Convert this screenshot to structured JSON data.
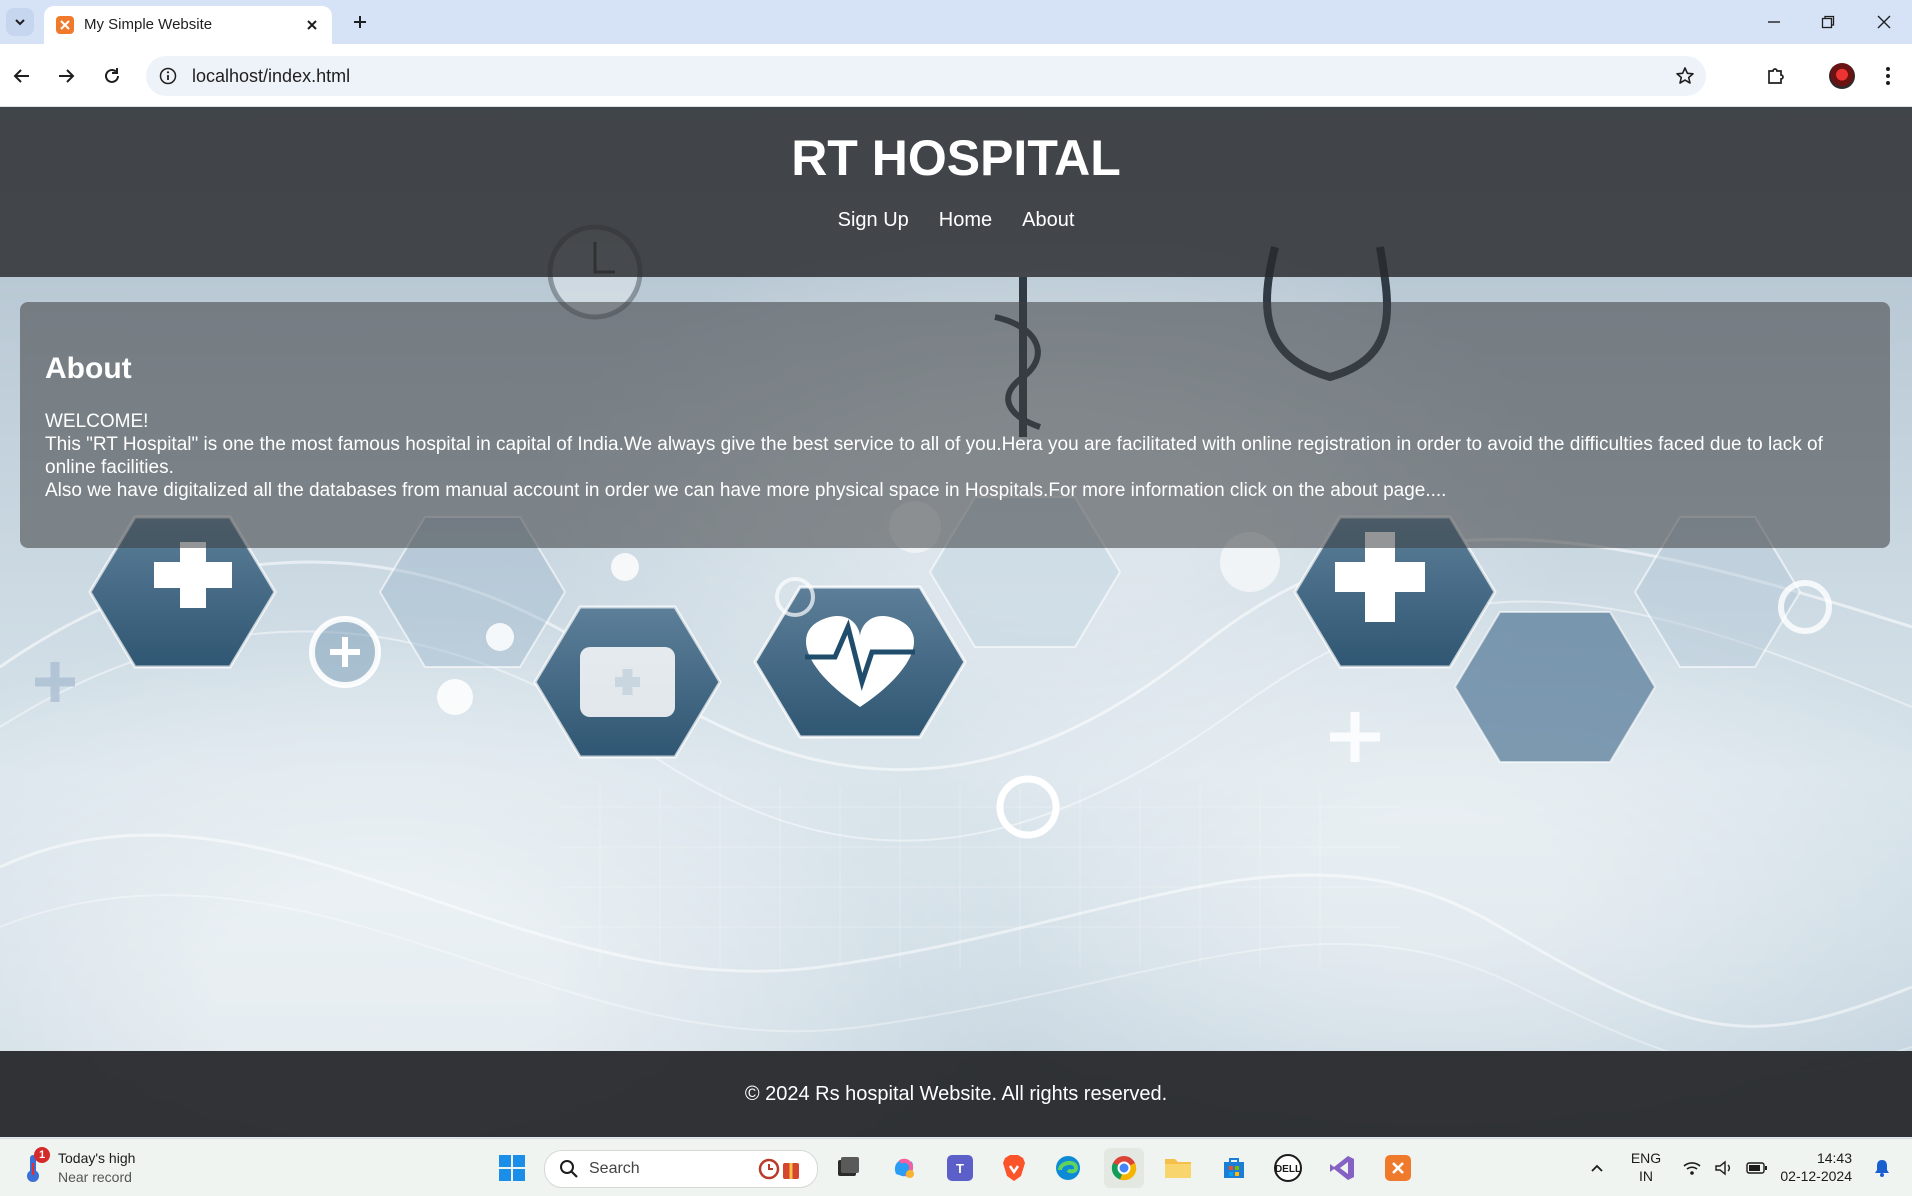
{
  "browser": {
    "tab_title": "My Simple Website",
    "url": "localhost/index.html"
  },
  "site": {
    "title": "RT HOSPITAL",
    "nav": [
      "Sign Up",
      "Home",
      "About"
    ],
    "about": {
      "heading": "About",
      "welcome": "WELCOME!",
      "paragraph1": "This \"RT Hospital\" is one the most famous hospital in capital of India.We always give the best service to all of you.Hera you are facilitated with online registration in order to avoid the difficulties faced due to lack of online facilities.",
      "paragraph2": "Also we have digitalized all the databases from manual account in order we can have more physical space in Hospitals.For more information click on the about page...."
    },
    "footer": "© 2024 Rs hospital Website. All rights reserved."
  },
  "taskbar": {
    "weather_badge": "1",
    "weather_title": "Today's high",
    "weather_subtitle": "Near record",
    "search_placeholder": "Search",
    "apps": [
      "start-icon",
      "task-view-icon",
      "copilot-icon",
      "teams-icon",
      "brave-icon",
      "edge-icon",
      "chrome-icon",
      "file-explorer-icon",
      "store-icon",
      "dell-icon",
      "visual-studio-icon",
      "xampp-icon"
    ],
    "lang_line1": "ENG",
    "lang_line2": "IN",
    "time": "14:43",
    "date": "02-12-2024"
  },
  "colors": {
    "header_bg": "#2a2c2e",
    "footer_bg": "#232528",
    "xampp_orange": "#f07a2b",
    "tab_strip": "#d6e3f7"
  }
}
